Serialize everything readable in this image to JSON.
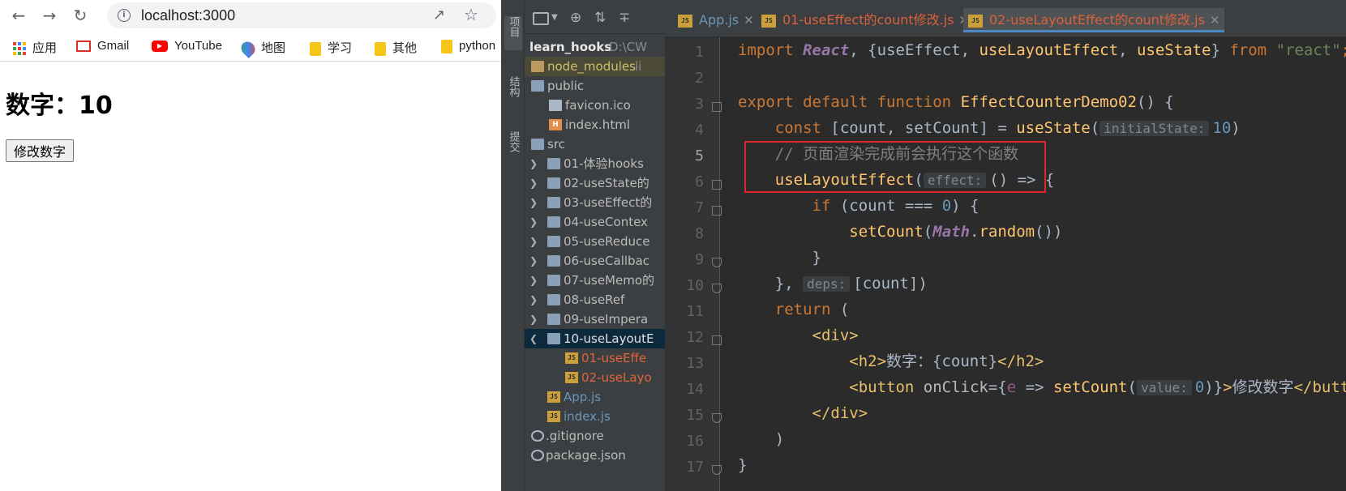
{
  "browser": {
    "url": "localhost:3000",
    "bookmarks": [
      {
        "label": "应用",
        "icon": "apps-icon"
      },
      {
        "label": "Gmail",
        "icon": "gmail-icon"
      },
      {
        "label": "YouTube",
        "icon": "youtube-icon"
      },
      {
        "label": "地图",
        "icon": "maps-icon"
      },
      {
        "label": "学习",
        "icon": "folder-icon"
      },
      {
        "label": "其他",
        "icon": "folder-icon"
      },
      {
        "label": "python",
        "icon": "folder-icon"
      }
    ],
    "page": {
      "heading": "数字：10",
      "button_label": "修改数字"
    }
  },
  "ide": {
    "tool_tabs": [
      "项目",
      "结构",
      "提交"
    ],
    "project": {
      "root_name": "learn_hooks",
      "root_path": "D:\\CW",
      "items": [
        {
          "label": "node_modules",
          "suffix": "li",
          "type": "folder-excluded"
        },
        {
          "label": "public",
          "type": "folder"
        },
        {
          "label": "favicon.ico",
          "type": "file"
        },
        {
          "label": "index.html",
          "type": "html"
        },
        {
          "label": "src",
          "type": "folder"
        },
        {
          "label": "01-体验hooks",
          "type": "folder"
        },
        {
          "label": "02-useState的",
          "type": "folder"
        },
        {
          "label": "03-useEffect的",
          "type": "folder"
        },
        {
          "label": "04-useContex",
          "type": "folder"
        },
        {
          "label": "05-useReduce",
          "type": "folder"
        },
        {
          "label": "06-useCallbac",
          "type": "folder"
        },
        {
          "label": "07-useMemo的",
          "type": "folder"
        },
        {
          "label": "08-useRef",
          "type": "folder"
        },
        {
          "label": "09-useImpera",
          "type": "folder"
        },
        {
          "label": "10-useLayoutE",
          "type": "folder"
        },
        {
          "label": "01-useEffe",
          "type": "js"
        },
        {
          "label": "02-useLayo",
          "type": "js"
        },
        {
          "label": "App.js",
          "type": "js"
        },
        {
          "label": "index.js",
          "type": "js"
        },
        {
          "label": ".gitignore",
          "type": "gear"
        },
        {
          "label": "package.json",
          "type": "gear"
        }
      ]
    },
    "tabs": [
      {
        "label": "App.js"
      },
      {
        "label": "01-useEffect的count修改.js"
      },
      {
        "label": "02-useLayoutEffect的count修改.js"
      }
    ],
    "line_numbers": [
      "1",
      "2",
      "3",
      "4",
      "5",
      "6",
      "7",
      "8",
      "9",
      "10",
      "11",
      "12",
      "13",
      "14",
      "15",
      "16",
      "17"
    ],
    "code": {
      "l1_import": "import",
      "l1_react": "React",
      "l1_mid": ", {",
      "l1_use_effect": "useEffect",
      "l1_comma1": ", ",
      "l1_use_layout": "useLayoutEffect",
      "l1_comma2": ", ",
      "l1_use_state": "useState",
      "l1_close": "} ",
      "l1_from": "from",
      "l1_str": "\"react\"",
      "l1_semi": ";",
      "l3_export": "export default function",
      "l3_name": "EffectCounterDemo02",
      "l3_rest": "() {",
      "l4_const": "const",
      "l4_vars": "[count, setCount] = ",
      "l4_fn": "useState",
      "l4_open": "(",
      "l4_hint": "initialState:",
      "l4_num": "10",
      "l4_close": ")",
      "l5_comment": "// 页面渲染完成前会执行这个函数",
      "l6_fn": "useLayoutEffect",
      "l6_open": "(",
      "l6_hint": "effect:",
      "l6_rest": "() => {",
      "l7_if": "if",
      "l7_cond": "(count === ",
      "l7_num": "0",
      "l7_close": ") {",
      "l8_fn": "setCount",
      "l8_open": "(",
      "l8_math": "Math",
      "l8_dot": ".",
      "l8_random": "random",
      "l8_close": "())",
      "l9": "}",
      "l10_open": "}, ",
      "l10_hint": "deps:",
      "l10_rest": "[count])",
      "l11_return": "return",
      "l11_rest": " (",
      "l12_tag": "<div>",
      "l13_tag_open": "<h2>",
      "l13_text": "数字：{count}",
      "l13_tag_close": "</h2>",
      "l14_tag_open": "<button",
      "l14_attr": " onClick",
      "l14_eq": "={",
      "l14_param": "e",
      "l14_arrow": " => ",
      "l14_fn": "setCount",
      "l14_paren": "(",
      "l14_hint": "value:",
      "l14_num": "0",
      "l14_close": ")}",
      "l14_gt": ">",
      "l14_text": "修改数字",
      "l14_end": "</button>",
      "l15_tag": "</div>",
      "l16": ")",
      "l17": "}"
    }
  }
}
